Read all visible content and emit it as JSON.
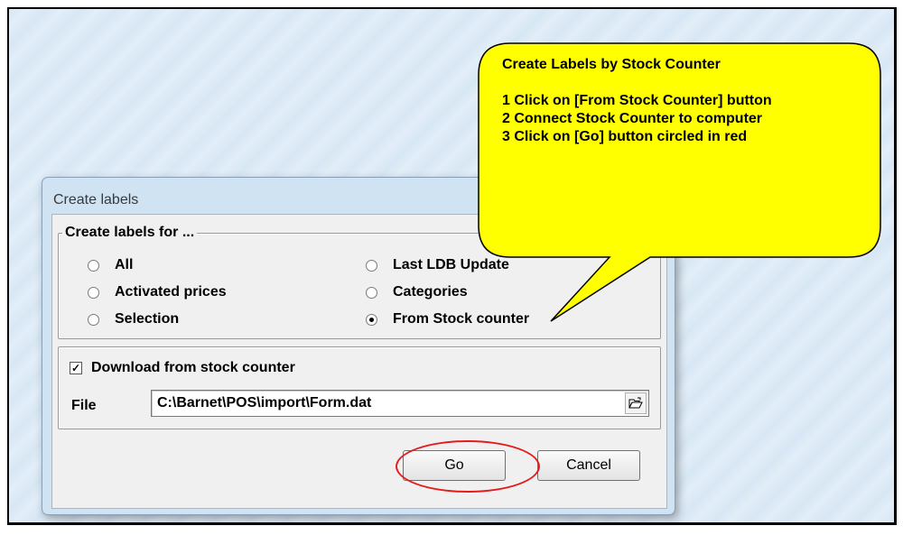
{
  "window": {
    "title": "Create labels"
  },
  "group_create_for": {
    "legend": "Create labels for ...",
    "options": [
      {
        "label": "All",
        "checked": false
      },
      {
        "label": "Last LDB Update",
        "checked": false
      },
      {
        "label": "Activated prices",
        "checked": false
      },
      {
        "label": "Categories",
        "checked": false
      },
      {
        "label": "Selection",
        "checked": false
      },
      {
        "label": "From Stock counter",
        "checked": true
      }
    ]
  },
  "download": {
    "checkbox_label": "Download from stock counter",
    "checked": true,
    "file_label": "File",
    "file_value": "C:\\Barnet\\POS\\import\\Form.dat"
  },
  "buttons": {
    "go": "Go",
    "cancel": "Cancel"
  },
  "callout": {
    "title": "Create Labels by Stock Counter",
    "steps": [
      "1 Click on [From Stock Counter] button",
      "2 Connect Stock Counter to computer",
      "3 Click on [Go] button circled in red"
    ],
    "fill_color": "#ffff00",
    "highlight_color": "#e31b1b"
  }
}
